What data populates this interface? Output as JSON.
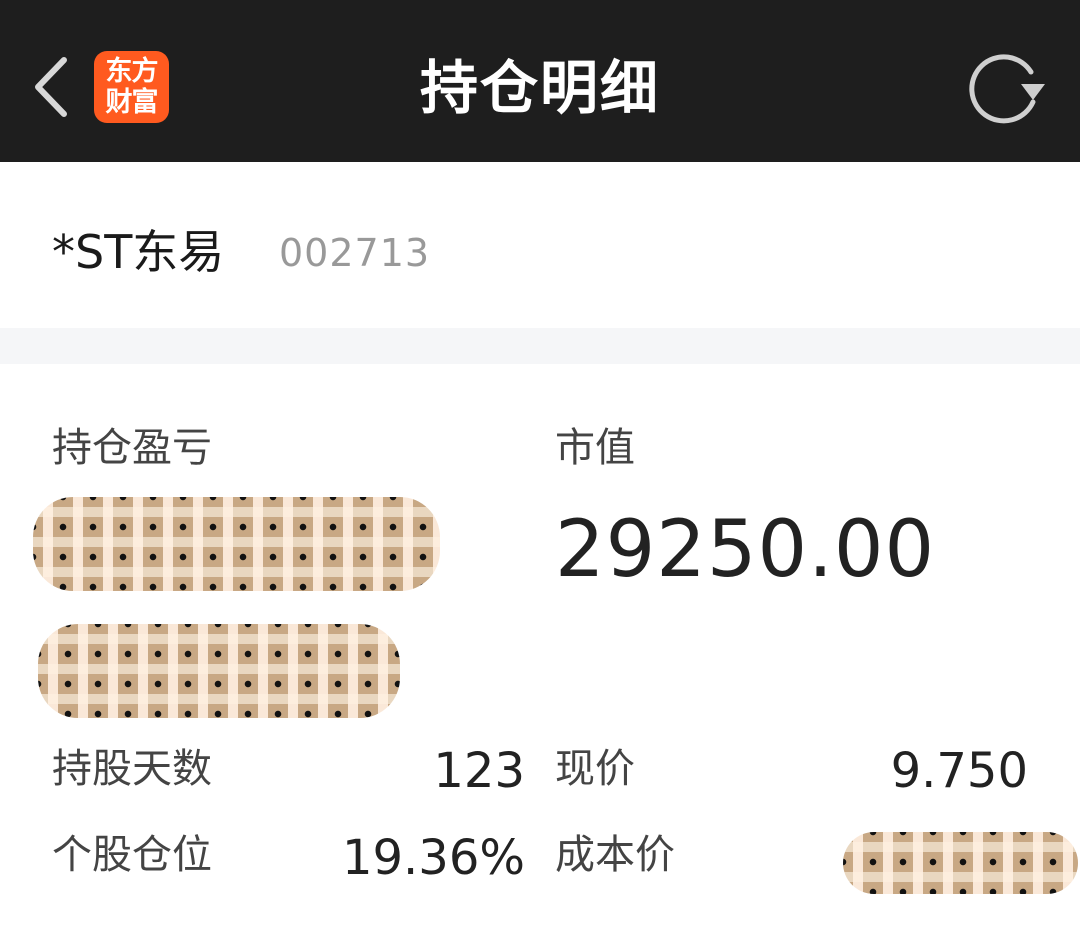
{
  "header": {
    "title": "持仓明细",
    "logo_line1": "东方",
    "logo_line2": "财富",
    "back_icon": "chevron-left-icon",
    "refresh_icon": "refresh-icon",
    "background": "#1e1e1e",
    "logo_color": "#ff5a1f"
  },
  "stock": {
    "name": "*ST东易",
    "code": "002713"
  },
  "position": {
    "pnl_label": "持仓盈亏",
    "market_value_label": "市值",
    "market_value": "29250.00",
    "holding_days_label": "持股天数",
    "holding_days": "123",
    "current_price_label": "现价",
    "current_price": "9.750",
    "position_ratio_label": "个股仓位",
    "position_ratio": "19.36%",
    "cost_price_label": "成本价"
  }
}
